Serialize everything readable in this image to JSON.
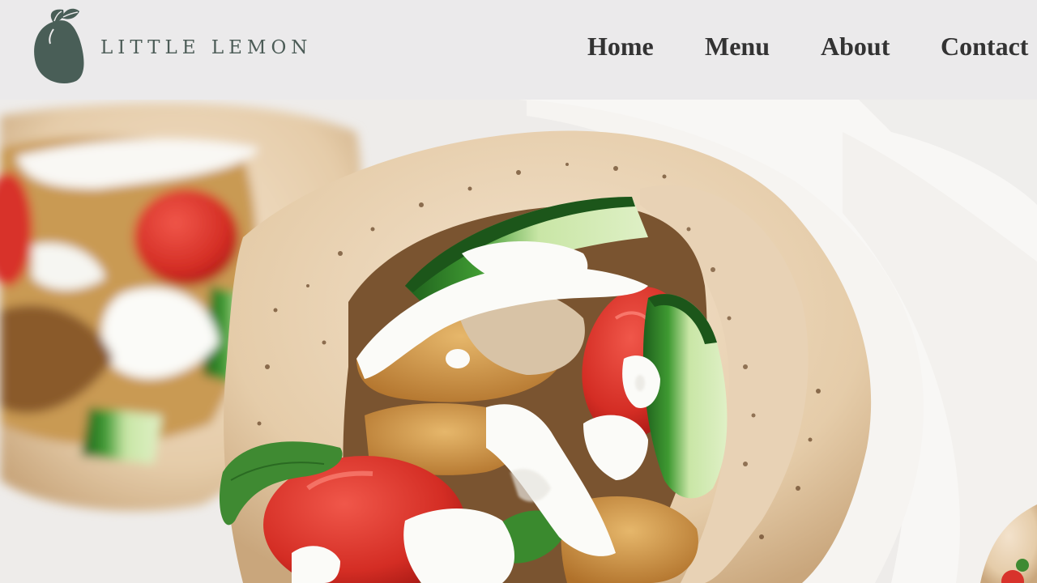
{
  "brand": {
    "name": "LITTLE LEMON",
    "logo_icon": "lemon-icon",
    "logo_color": "#495e57"
  },
  "nav": {
    "items": [
      {
        "label": "Home"
      },
      {
        "label": "Menu"
      },
      {
        "label": "About"
      },
      {
        "label": "Contact"
      }
    ]
  },
  "hero": {
    "image": "pita-wraps-photo",
    "colors": {
      "pita": "#e9d3b8",
      "tomato": "#d8332b",
      "cucumber": "#2f7d2c",
      "sauce": "#fbfbf8",
      "chicken": "#c98d3f",
      "paper": "#f7f6f4"
    }
  }
}
